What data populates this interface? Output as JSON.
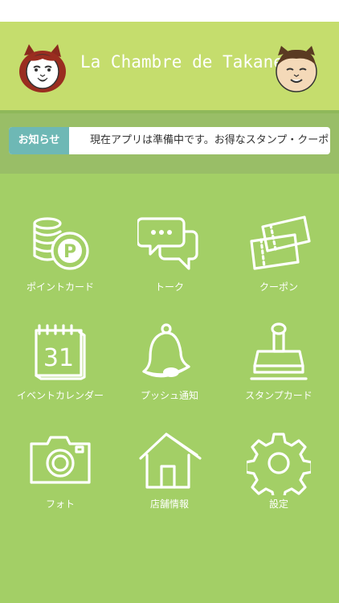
{
  "header": {
    "title": "La Chambre de Takane"
  },
  "notice": {
    "badge": "お知らせ",
    "message": "現在アプリは準備中です。お得なスタンプ・クーポ"
  },
  "menu": [
    {
      "label": "ポイントカード",
      "icon": "point-card-icon"
    },
    {
      "label": "トーク",
      "icon": "chat-bubbles-icon"
    },
    {
      "label": "クーポン",
      "icon": "coupon-icon"
    },
    {
      "label": "イベントカレンダー",
      "icon": "calendar-icon",
      "calendar_day": "31"
    },
    {
      "label": "プッシュ通知",
      "icon": "bell-icon"
    },
    {
      "label": "スタンプカード",
      "icon": "stamp-icon"
    },
    {
      "label": "フォト",
      "icon": "camera-icon"
    },
    {
      "label": "店舗情報",
      "icon": "house-icon"
    },
    {
      "label": "設定",
      "icon": "gear-icon"
    }
  ],
  "colors": {
    "background": "#a3cf66",
    "header": "#c5dd6d",
    "notice_badge": "#6eb8b5",
    "icon": "#ffffff"
  }
}
